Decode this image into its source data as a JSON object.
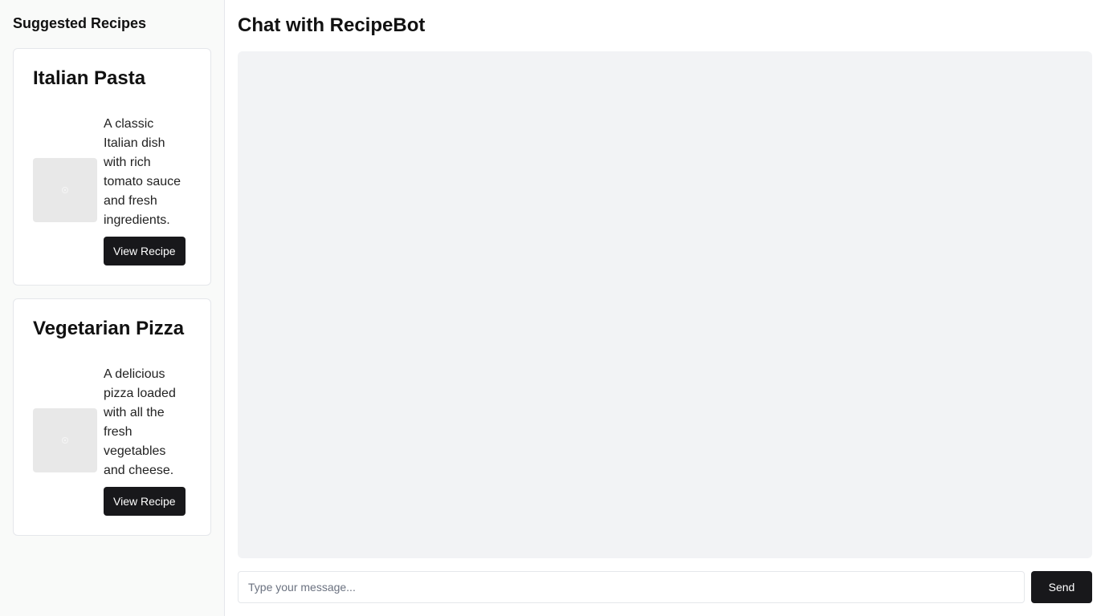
{
  "sidebar": {
    "title": "Suggested Recipes",
    "recipes": [
      {
        "title": "Italian Pasta",
        "description": "A classic Italian dish with rich tomato sauce and fresh ingredients.",
        "image_icon": "image-placeholder-icon",
        "button_label": "View Recipe"
      },
      {
        "title": "Vegetarian Pizza",
        "description": "A delicious pizza loaded with all the fresh vegetables and cheese.",
        "image_icon": "image-placeholder-icon",
        "button_label": "View Recipe"
      }
    ]
  },
  "chat": {
    "title": "Chat with RecipeBot",
    "input_placeholder": "Type your message...",
    "input_value": "",
    "send_label": "Send"
  },
  "colors": {
    "button_bg": "#18181b",
    "chat_bg": "#f2f3f5",
    "sidebar_bg": "#f9faf9"
  }
}
